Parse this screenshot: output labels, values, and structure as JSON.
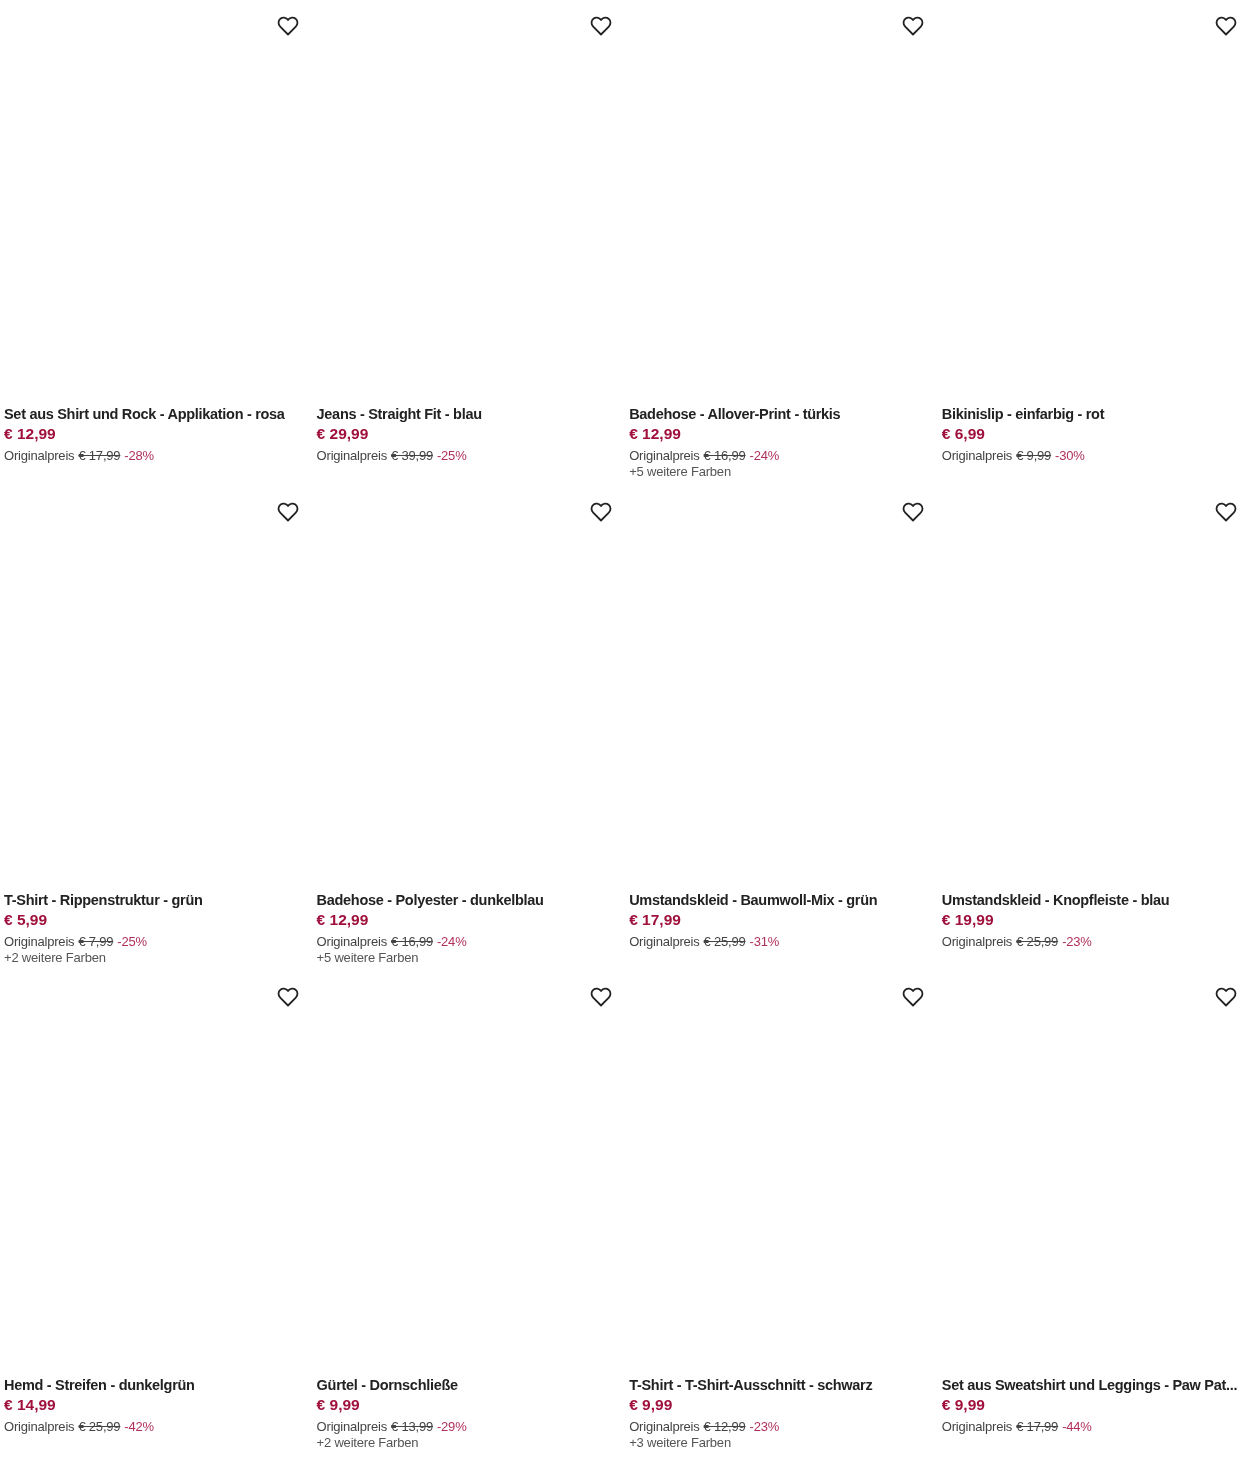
{
  "products": [
    {
      "title": "Set aus Shirt und Rock - Applikation - rosa",
      "price": "€ 12,99",
      "original_label": "Originalpreis",
      "original_price": "€ 17,99",
      "discount": "-28%"
    },
    {
      "title": "Jeans - Straight Fit - blau",
      "price": "€ 29,99",
      "original_label": "Originalpreis",
      "original_price": "€ 39,99",
      "discount": "-25%"
    },
    {
      "title": "Badehose - Allover-Print - türkis",
      "price": "€ 12,99",
      "original_label": "Originalpreis",
      "original_price": "€ 16,99",
      "discount": "-24%",
      "more_colors": "+5 weitere Farben"
    },
    {
      "title": "Bikinislip - einfarbig - rot",
      "price": "€ 6,99",
      "original_label": "Originalpreis",
      "original_price": "€ 9,99",
      "discount": "-30%"
    },
    {
      "title": "T-Shirt - Rippenstruktur - grün",
      "price": "€ 5,99",
      "original_label": "Originalpreis",
      "original_price": "€ 7,99",
      "discount": "-25%",
      "more_colors": "+2 weitere Farben"
    },
    {
      "title": "Badehose - Polyester - dunkelblau",
      "price": "€ 12,99",
      "original_label": "Originalpreis",
      "original_price": "€ 16,99",
      "discount": "-24%",
      "more_colors": "+5 weitere Farben"
    },
    {
      "title": "Umstandskleid - Baumwoll-Mix - grün",
      "price": "€ 17,99",
      "original_label": "Originalpreis",
      "original_price": "€ 25,99",
      "discount": "-31%"
    },
    {
      "title": "Umstandskleid - Knopfleiste - blau",
      "price": "€ 19,99",
      "original_label": "Originalpreis",
      "original_price": "€ 25,99",
      "discount": "-23%"
    },
    {
      "title": "Hemd - Streifen - dunkelgrün",
      "price": "€ 14,99",
      "original_label": "Originalpreis",
      "original_price": "€ 25,99",
      "discount": "-42%"
    },
    {
      "title": "Gürtel - Dornschließe",
      "price": "€ 9,99",
      "original_label": "Originalpreis",
      "original_price": "€ 13,99",
      "discount": "-29%",
      "more_colors": "+2 weitere Farben"
    },
    {
      "title": "T-Shirt - T-Shirt-Ausschnitt - schwarz",
      "price": "€ 9,99",
      "original_label": "Originalpreis",
      "original_price": "€ 12,99",
      "discount": "-23%",
      "more_colors": "+3 weitere Farben"
    },
    {
      "title": "Set aus Sweatshirt und Leggings - Paw Pat...",
      "price": "€ 9,99",
      "original_label": "Originalpreis",
      "original_price": "€ 17,99",
      "discount": "-44%"
    }
  ]
}
